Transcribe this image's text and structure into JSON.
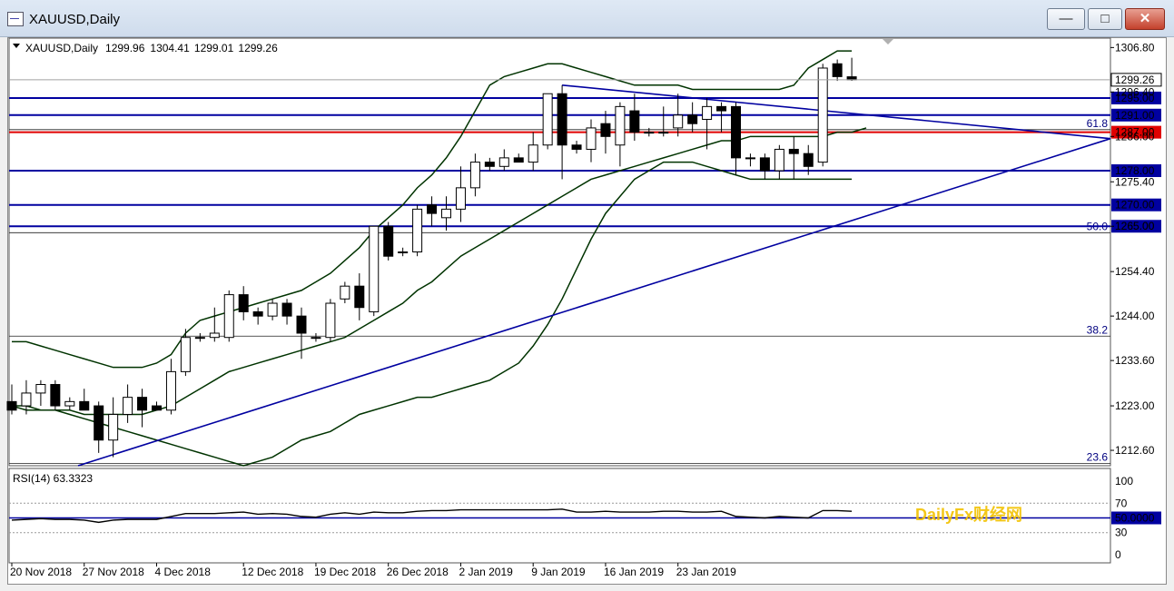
{
  "window": {
    "title": "XAUUSD,Daily",
    "minimize_glyph": "—",
    "maximize_glyph": "□",
    "close_glyph": "✕"
  },
  "chart_data": {
    "type": "candlestick",
    "header": {
      "symbol": "XAUUSD,Daily",
      "open": "1299.96",
      "high": "1304.41",
      "low": "1299.01",
      "close": "1299.26"
    },
    "current_price_label": "1299.26",
    "y_ticks": [
      "1306.80",
      "1296.40",
      "1286.00",
      "1275.40",
      "1265.00",
      "1254.40",
      "1244.00",
      "1233.60",
      "1223.00",
      "1212.60"
    ],
    "ylim": [
      1209,
      1309
    ],
    "x_labels": [
      {
        "text": "20 Nov 2018",
        "i": 0
      },
      {
        "text": "27 Nov 2018",
        "i": 5
      },
      {
        "text": "4 Dec 2018",
        "i": 10
      },
      {
        "text": "12 Dec 2018",
        "i": 16
      },
      {
        "text": "19 Dec 2018",
        "i": 21
      },
      {
        "text": "26 Dec 2018",
        "i": 26
      },
      {
        "text": "2 Jan 2019",
        "i": 31
      },
      {
        "text": "9 Jan 2019",
        "i": 36
      },
      {
        "text": "16 Jan 2019",
        "i": 41
      },
      {
        "text": "23 Jan 2019",
        "i": 46
      }
    ],
    "candles": [
      {
        "o": 1224,
        "h": 1228,
        "l": 1221,
        "c": 1222
      },
      {
        "o": 1223,
        "h": 1229,
        "l": 1221,
        "c": 1226
      },
      {
        "o": 1226,
        "h": 1229,
        "l": 1223,
        "c": 1228
      },
      {
        "o": 1228,
        "h": 1229,
        "l": 1222,
        "c": 1223
      },
      {
        "o": 1223,
        "h": 1225,
        "l": 1222,
        "c": 1224
      },
      {
        "o": 1224,
        "h": 1227,
        "l": 1222,
        "c": 1222
      },
      {
        "o": 1223,
        "h": 1224,
        "l": 1212,
        "c": 1215
      },
      {
        "o": 1215,
        "h": 1225,
        "l": 1211,
        "c": 1221
      },
      {
        "o": 1221,
        "h": 1228,
        "l": 1219,
        "c": 1225
      },
      {
        "o": 1225,
        "h": 1227,
        "l": 1218,
        "c": 1222
      },
      {
        "o": 1223,
        "h": 1224,
        "l": 1222,
        "c": 1222
      },
      {
        "o": 1222,
        "h": 1234,
        "l": 1221,
        "c": 1231
      },
      {
        "o": 1231,
        "h": 1241,
        "l": 1230,
        "c": 1239
      },
      {
        "o": 1239,
        "h": 1240,
        "l": 1238,
        "c": 1239
      },
      {
        "o": 1239,
        "h": 1246,
        "l": 1238,
        "c": 1240
      },
      {
        "o": 1239,
        "h": 1250,
        "l": 1238,
        "c": 1249
      },
      {
        "o": 1249,
        "h": 1251,
        "l": 1243,
        "c": 1245
      },
      {
        "o": 1245,
        "h": 1246,
        "l": 1242,
        "c": 1244
      },
      {
        "o": 1244,
        "h": 1248,
        "l": 1243,
        "c": 1247
      },
      {
        "o": 1247,
        "h": 1248,
        "l": 1242,
        "c": 1244
      },
      {
        "o": 1244,
        "h": 1246,
        "l": 1234,
        "c": 1240
      },
      {
        "o": 1239,
        "h": 1240,
        "l": 1238,
        "c": 1239
      },
      {
        "o": 1239,
        "h": 1248,
        "l": 1238,
        "c": 1247
      },
      {
        "o": 1248,
        "h": 1252,
        "l": 1247,
        "c": 1251
      },
      {
        "o": 1251,
        "h": 1254,
        "l": 1243,
        "c": 1246
      },
      {
        "o": 1245,
        "h": 1264,
        "l": 1244,
        "c": 1265
      },
      {
        "o": 1265,
        "h": 1266,
        "l": 1257,
        "c": 1258
      },
      {
        "o": 1259,
        "h": 1260,
        "l": 1258,
        "c": 1259
      },
      {
        "o": 1259,
        "h": 1270,
        "l": 1258,
        "c": 1269
      },
      {
        "o": 1270,
        "h": 1272,
        "l": 1265,
        "c": 1268
      },
      {
        "o": 1267,
        "h": 1272,
        "l": 1264,
        "c": 1269
      },
      {
        "o": 1269,
        "h": 1279,
        "l": 1266,
        "c": 1274
      },
      {
        "o": 1274,
        "h": 1282,
        "l": 1272,
        "c": 1280
      },
      {
        "o": 1280,
        "h": 1281,
        "l": 1278,
        "c": 1279
      },
      {
        "o": 1279,
        "h": 1283,
        "l": 1278,
        "c": 1281
      },
      {
        "o": 1281,
        "h": 1282,
        "l": 1280,
        "c": 1280
      },
      {
        "o": 1280,
        "h": 1287,
        "l": 1278,
        "c": 1284
      },
      {
        "o": 1284,
        "h": 1296,
        "l": 1283,
        "c": 1296
      },
      {
        "o": 1296,
        "h": 1298,
        "l": 1276,
        "c": 1284
      },
      {
        "o": 1284,
        "h": 1285,
        "l": 1282,
        "c": 1283
      },
      {
        "o": 1283,
        "h": 1290,
        "l": 1280,
        "c": 1288
      },
      {
        "o": 1289,
        "h": 1292,
        "l": 1282,
        "c": 1286
      },
      {
        "o": 1284,
        "h": 1294,
        "l": 1279,
        "c": 1293
      },
      {
        "o": 1292,
        "h": 1296,
        "l": 1285,
        "c": 1287
      },
      {
        "o": 1287,
        "h": 1288,
        "l": 1286,
        "c": 1287
      },
      {
        "o": 1287,
        "h": 1293,
        "l": 1286,
        "c": 1287
      },
      {
        "o": 1288,
        "h": 1296,
        "l": 1286,
        "c": 1291
      },
      {
        "o": 1291,
        "h": 1294,
        "l": 1287,
        "c": 1289
      },
      {
        "o": 1290,
        "h": 1295,
        "l": 1283,
        "c": 1293
      },
      {
        "o": 1293,
        "h": 1294,
        "l": 1287,
        "c": 1292
      },
      {
        "o": 1293,
        "h": 1294,
        "l": 1277,
        "c": 1281
      },
      {
        "o": 1281,
        "h": 1282,
        "l": 1279,
        "c": 1281
      },
      {
        "o": 1281,
        "h": 1282,
        "l": 1276,
        "c": 1278
      },
      {
        "o": 1278,
        "h": 1284,
        "l": 1276,
        "c": 1283
      },
      {
        "o": 1283,
        "h": 1286,
        "l": 1276,
        "c": 1282
      },
      {
        "o": 1282,
        "h": 1284,
        "l": 1277,
        "c": 1279
      },
      {
        "o": 1280,
        "h": 1303,
        "l": 1279,
        "c": 1302
      },
      {
        "o": 1303,
        "h": 1304,
        "l": 1299,
        "c": 1300
      },
      {
        "o": 1299.96,
        "h": 1304.41,
        "l": 1299.01,
        "c": 1299.26
      }
    ],
    "bollinger": {
      "middle": [
        1223,
        1222,
        1222,
        1222,
        1222,
        1221,
        1221,
        1221,
        1221,
        1221,
        1222,
        1223,
        1225,
        1227,
        1229,
        1231,
        1232,
        1233,
        1234,
        1235,
        1236,
        1237,
        1238,
        1239,
        1241,
        1243,
        1245,
        1247,
        1250,
        1252,
        1255,
        1258,
        1260,
        1262,
        1264,
        1266,
        1268,
        1270,
        1272,
        1274,
        1276,
        1277,
        1278,
        1279,
        1280,
        1281,
        1282,
        1283,
        1284,
        1285,
        1285,
        1286,
        1286,
        1286,
        1286,
        1286,
        1286,
        1287,
        1287,
        1288
      ],
      "upper": [
        1238,
        1238,
        1237,
        1236,
        1235,
        1234,
        1233,
        1232,
        1232,
        1232,
        1233,
        1235,
        1240,
        1243,
        1244,
        1245,
        1246,
        1247,
        1248,
        1249,
        1250,
        1252,
        1254,
        1257,
        1260,
        1264,
        1267,
        1270,
        1274,
        1277,
        1281,
        1286,
        1292,
        1298,
        1300,
        1301,
        1302,
        1303,
        1303,
        1302,
        1301,
        1300,
        1299,
        1298,
        1298,
        1298,
        1298,
        1297,
        1297,
        1297,
        1297,
        1297,
        1297,
        1297,
        1298,
        1302,
        1304,
        1306,
        1306
      ],
      "lower": [
        1223,
        1223,
        1222,
        1222,
        1221,
        1220,
        1219,
        1218,
        1217,
        1216,
        1215,
        1214,
        1213,
        1212,
        1211,
        1210,
        1209,
        1210,
        1211,
        1213,
        1215,
        1216,
        1217,
        1219,
        1221,
        1222,
        1223,
        1224,
        1225,
        1225,
        1226,
        1227,
        1228,
        1229,
        1231,
        1233,
        1237,
        1242,
        1248,
        1255,
        1262,
        1268,
        1272,
        1276,
        1278,
        1280,
        1280,
        1280,
        1279,
        1278,
        1277,
        1276,
        1276,
        1276,
        1276,
        1276,
        1276,
        1276,
        1276
      ]
    },
    "horizontal_levels": [
      {
        "value": 1295.0,
        "label": "1295.00",
        "color": "#0000a0"
      },
      {
        "value": 1291.0,
        "label": "1291.00",
        "color": "#0000a0"
      },
      {
        "value": 1287.0,
        "label": "1287.00",
        "color": "#e00000"
      },
      {
        "value": 1278.0,
        "label": "1278.00",
        "color": "#0000a0"
      },
      {
        "value": 1270.0,
        "label": "1270.00",
        "color": "#0000a0"
      },
      {
        "value": 1265.0,
        "label": "1265.00",
        "color": "#0000a0"
      }
    ],
    "fib_levels": [
      {
        "label": "61.8",
        "value": 1287.6
      },
      {
        "label": "50.0",
        "value": 1263.5
      },
      {
        "label": "38.2",
        "value": 1239.3
      },
      {
        "label": "23.6",
        "value": 1209.5
      }
    ],
    "rsi": {
      "label": "RSI(14) 63.3323",
      "level_label": "50.0000",
      "ticks": [
        "100",
        "70",
        "50",
        "30",
        "0"
      ],
      "values": [
        47,
        48,
        49,
        48,
        48,
        47,
        44,
        47,
        48,
        48,
        48,
        52,
        56,
        56,
        56,
        57,
        58,
        55,
        56,
        55,
        52,
        51,
        55,
        57,
        55,
        58,
        57,
        57,
        59,
        60,
        60,
        61,
        61,
        61,
        61,
        61,
        61,
        61,
        62,
        58,
        58,
        59,
        58,
        58,
        58,
        59,
        59,
        58,
        58,
        59,
        52,
        51,
        50,
        52,
        51,
        50,
        60,
        60,
        59
      ]
    },
    "watermark": "DailyFx财经网",
    "colors": {
      "bull_fill": "#ffffff",
      "bear_fill": "#000000",
      "bb": "#003300",
      "trend": "#0000a0",
      "level": "#0000a0",
      "key_level": "#e00000"
    }
  }
}
